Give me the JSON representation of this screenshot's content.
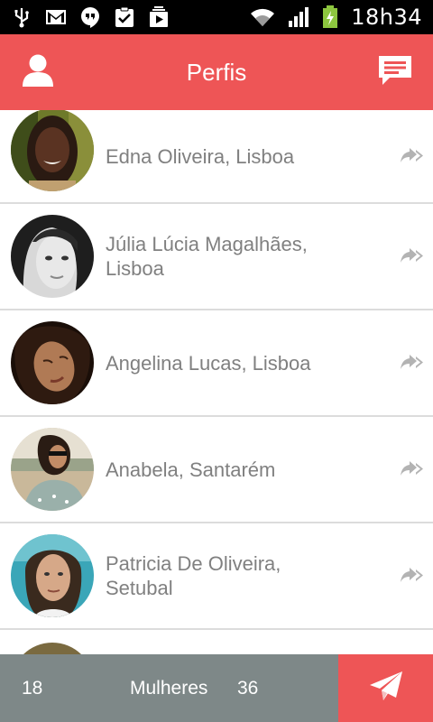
{
  "status_bar": {
    "time": "18h34",
    "left_icons": [
      "usb-icon",
      "gmail-icon",
      "hangouts-icon",
      "clipboard-check-icon",
      "media-icon"
    ],
    "right_icons": [
      "wifi-icon",
      "signal-icon",
      "battery-charging-icon"
    ]
  },
  "header": {
    "title": "Perfis",
    "background": "#ee5556"
  },
  "profiles": [
    {
      "name": "Edna Oliveira, Lisboa"
    },
    {
      "name": "Júlia Lúcia Magalhães, Lisboa"
    },
    {
      "name": "Angelina Lucas, Lisboa"
    },
    {
      "name": "Anabela, Santarém"
    },
    {
      "name": "Patricia De Oliveira, Setubal"
    }
  ],
  "footer": {
    "min_value": "18",
    "category": "Mulheres",
    "max_value": "36",
    "background": "#7e8888",
    "send_background": "#ee5556"
  }
}
